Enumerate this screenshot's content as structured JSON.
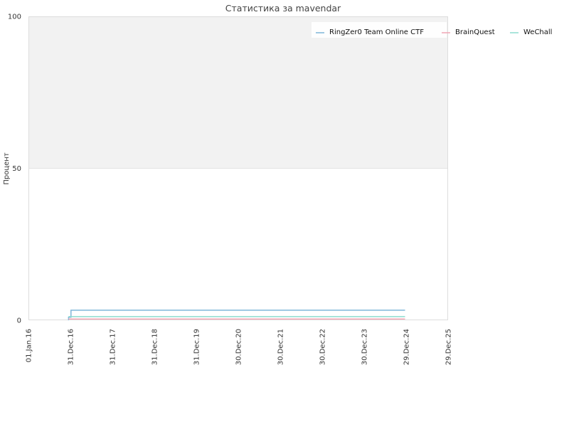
{
  "chart_data": {
    "type": "line",
    "title": "Статистика за mavendar",
    "ylabel": "Процент",
    "xlabel": "",
    "ylim": [
      0,
      100
    ],
    "y_ticks": [
      "0",
      "50",
      "100"
    ],
    "x_ticks": [
      "01.Jan.16",
      "31.Dec.16",
      "31.Dec.17",
      "31.Dec.18",
      "31.Dec.19",
      "30.Dec.20",
      "30.Dec.21",
      "30.Dec.22",
      "30.Dec.23",
      "29.Dec.24",
      "29.Dec.25"
    ],
    "xlim": [
      "2016-01-01",
      "2025-12-29"
    ],
    "grid": true,
    "shaded_band": [
      50,
      100
    ],
    "legend_position": "top-right",
    "series": [
      {
        "name": "RingZer0 Team Online CTF",
        "color": "#7eb6d9",
        "points": [
          {
            "x": "2016-12-15",
            "y": 0
          },
          {
            "x": "2016-12-15",
            "y": 1
          },
          {
            "x": "2017-01-05",
            "y": 1
          },
          {
            "x": "2017-01-05",
            "y": 3.3
          },
          {
            "x": "2024-12-20",
            "y": 3.3
          }
        ]
      },
      {
        "name": "BrainQuest",
        "color": "#f0a7b5",
        "points": [
          {
            "x": "2016-12-15",
            "y": 0.4
          },
          {
            "x": "2024-12-20",
            "y": 0.4
          }
        ]
      },
      {
        "name": "WeChall",
        "color": "#8ddccf",
        "points": [
          {
            "x": "2016-12-15",
            "y": 1.2
          },
          {
            "x": "2024-12-20",
            "y": 1.2
          }
        ]
      }
    ]
  }
}
